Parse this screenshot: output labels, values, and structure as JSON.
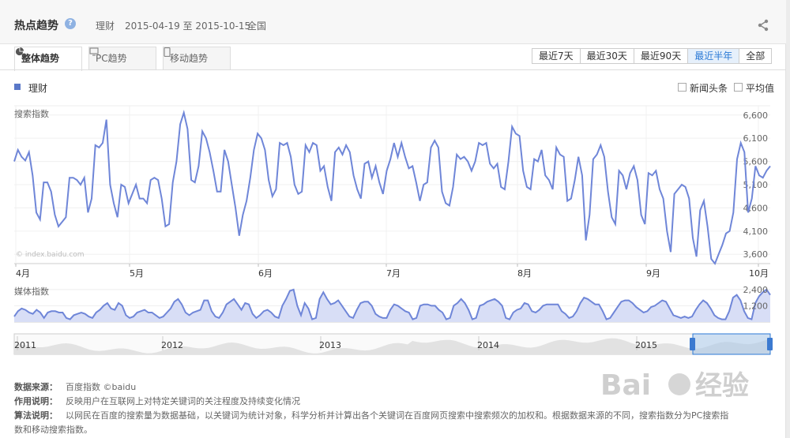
{
  "header": {
    "title": "热点趋势",
    "help_glyph": "?",
    "keyword": "理财",
    "date_range": "2015-04-19 至 2015-10-15",
    "region": "全国"
  },
  "tabs": [
    {
      "label": "整体趋势",
      "icon": "pie-chart-icon"
    },
    {
      "label": "PC趋势",
      "icon": "monitor-icon"
    },
    {
      "label": "移动趋势",
      "icon": "phone-icon"
    }
  ],
  "ranges": [
    "最近7天",
    "最近30天",
    "最近90天",
    "最近半年",
    "全部"
  ],
  "selected_range": "最近半年",
  "legend": {
    "series": "理财",
    "news_label": "新闻头条",
    "avg_label": "平均值"
  },
  "search": {
    "label": "搜索指数",
    "watermark": "© index.baidu.com",
    "y_ticks": [
      "6,600",
      "6,100",
      "5,600",
      "5,100",
      "4,600",
      "4,100",
      "3,600"
    ],
    "x_ticks": [
      "4月",
      "5月",
      "6月",
      "7月",
      "8月",
      "9月",
      "10月"
    ]
  },
  "media": {
    "label": "媒体指数",
    "y_ticks": [
      "2,400",
      "1,200"
    ]
  },
  "overview": {
    "years": [
      "2011",
      "2012",
      "2013",
      "2014",
      "2015"
    ]
  },
  "footer": {
    "source_label": "数据来源：",
    "source_value": "百度指数 ©baidu",
    "usage_label": "作用说明：",
    "usage_value": "反映用户在互联网上对特定关键词的关注程度及持续变化情况",
    "algo_label": "算法说明：",
    "algo_value": "以网民在百度的搜索量为数据基础，以关键词为统计对象，科学分析并计算出各个关键词在百度网页搜索中搜索频次的加权和。根据数据来源的不同，搜索指数分为PC搜索指",
    "algo_value2": "数和移动搜索指数。"
  },
  "colors": {
    "series": "#6f86d8",
    "media_fill": "#d8def6",
    "accent": "#2c7ad6"
  },
  "chart_data": [
    {
      "type": "line",
      "title": "搜索指数",
      "ylim": [
        3400,
        6800
      ],
      "series": [
        {
          "name": "理财",
          "values": [
            5600,
            5850,
            5700,
            5620,
            5800,
            5300,
            4500,
            4350,
            5150,
            5150,
            4950,
            4450,
            4200,
            4300,
            4400,
            5250,
            5250,
            5200,
            5100,
            5250,
            4500,
            4800,
            5950,
            5900,
            6000,
            6500,
            5100,
            4700,
            4400,
            5100,
            5050,
            4700,
            4900,
            5100,
            4800,
            4800,
            4700,
            5200,
            5250,
            5200,
            4800,
            4200,
            4250,
            5150,
            5600,
            6400,
            6650,
            6300,
            5200,
            5150,
            5500,
            6250,
            6100,
            5800,
            5400,
            4950,
            4950,
            5850,
            5600,
            5100,
            4600,
            4000,
            4450,
            4750,
            5250,
            5850,
            6200,
            6100,
            5850,
            5200,
            4850,
            5000,
            6000,
            5950,
            6000,
            5700,
            5100,
            4900,
            4950,
            5950,
            5800,
            6000,
            5950,
            5400,
            5500,
            5050,
            4750,
            5800,
            5900,
            5750,
            5950,
            5800,
            5300,
            5000,
            4800,
            5550,
            5600,
            5250,
            5500,
            5150,
            4900,
            5400,
            5650,
            6000,
            5700,
            6000,
            5700,
            5450,
            5500,
            5150,
            4750,
            5100,
            5150,
            5900,
            6050,
            5900,
            4950,
            4700,
            4650,
            5050,
            5750,
            5650,
            5700,
            5600,
            5400,
            5600,
            6000,
            5950,
            6000,
            5550,
            5450,
            5550,
            5050,
            5000,
            5600,
            6350,
            6200,
            6150,
            5400,
            5050,
            5000,
            5650,
            5600,
            5850,
            5300,
            5200,
            5000,
            5900,
            5750,
            5700,
            4750,
            4800,
            5200,
            5700,
            5300,
            3900,
            4450,
            5650,
            5750,
            5950,
            5700,
            4950,
            4400,
            4250,
            5400,
            5300,
            5000,
            5350,
            5500,
            5200,
            4450,
            4250,
            5350,
            5300,
            5400,
            5000,
            4800,
            4100,
            3650,
            4900,
            5000,
            5100,
            5050,
            4800,
            3950,
            3550,
            4550,
            4750,
            4200,
            3500,
            3400,
            3600,
            3800,
            4050,
            4100,
            4500,
            5650,
            6000,
            5800,
            4500,
            4800,
            5500,
            5300,
            5250,
            5400,
            5500
          ]
        }
      ],
      "y_ticks": [
        6600,
        6100,
        5600,
        5100,
        4600,
        4100,
        3600
      ],
      "x_ticks": [
        "4月",
        "5月",
        "6月",
        "7月",
        "8月",
        "9月",
        "10月"
      ],
      "grid": true
    },
    {
      "type": "area",
      "title": "媒体指数",
      "ylim": [
        0,
        2800
      ],
      "series": [
        {
          "name": "理财",
          "values": [
            400,
            800,
            1000,
            900,
            700,
            600,
            900,
            700,
            300,
            700,
            800,
            800,
            700,
            700,
            300,
            200,
            500,
            600,
            700,
            600,
            400,
            300,
            700,
            900,
            1200,
            1400,
            1000,
            900,
            1400,
            1200,
            500,
            300,
            400,
            700,
            800,
            900,
            700,
            700,
            500,
            300,
            400,
            700,
            1000,
            1500,
            1700,
            1300,
            700,
            500,
            700,
            800,
            900,
            1600,
            1600,
            800,
            400,
            300,
            700,
            1300,
            1500,
            1700,
            1300,
            900,
            1400,
            1300,
            600,
            300,
            500,
            800,
            900,
            700,
            400,
            300,
            1200,
            1700,
            2300,
            2400,
            1200,
            500,
            1400,
            1000,
            200,
            300,
            1700,
            2200,
            1700,
            1300,
            1400,
            1600,
            1200,
            800,
            400,
            300,
            900,
            1400,
            1500,
            1500,
            1200,
            600,
            400,
            300,
            300,
            900,
            1300,
            1200,
            1000,
            800,
            700,
            200,
            300,
            1200,
            1300,
            1300,
            1200,
            1200,
            900,
            700,
            200,
            300,
            1200,
            1400,
            1700,
            1400,
            900,
            200,
            300,
            1200,
            1300,
            1500,
            1600,
            1700,
            1500,
            1200,
            300,
            200,
            700,
            900,
            1000,
            1400,
            1300,
            800,
            700,
            900,
            1200,
            1300,
            1300,
            1300,
            1300,
            800,
            600,
            300,
            400,
            800,
            1400,
            1800,
            1700,
            1500,
            1300,
            1300,
            800,
            200,
            300,
            700,
            1100,
            1500,
            1600,
            1600,
            1400,
            1100,
            900,
            700,
            800,
            1100,
            1200,
            1400,
            1600,
            1500,
            1000,
            500,
            400,
            300,
            400,
            300,
            400,
            900,
            1300,
            1600,
            1400,
            1000,
            500,
            300,
            200,
            200,
            800,
            1800,
            2000,
            1600,
            800,
            300,
            200,
            1400,
            1900,
            2200,
            2400,
            2000
          ]
        }
      ],
      "y_ticks": [
        2400,
        1200
      ],
      "grid": true
    }
  ]
}
